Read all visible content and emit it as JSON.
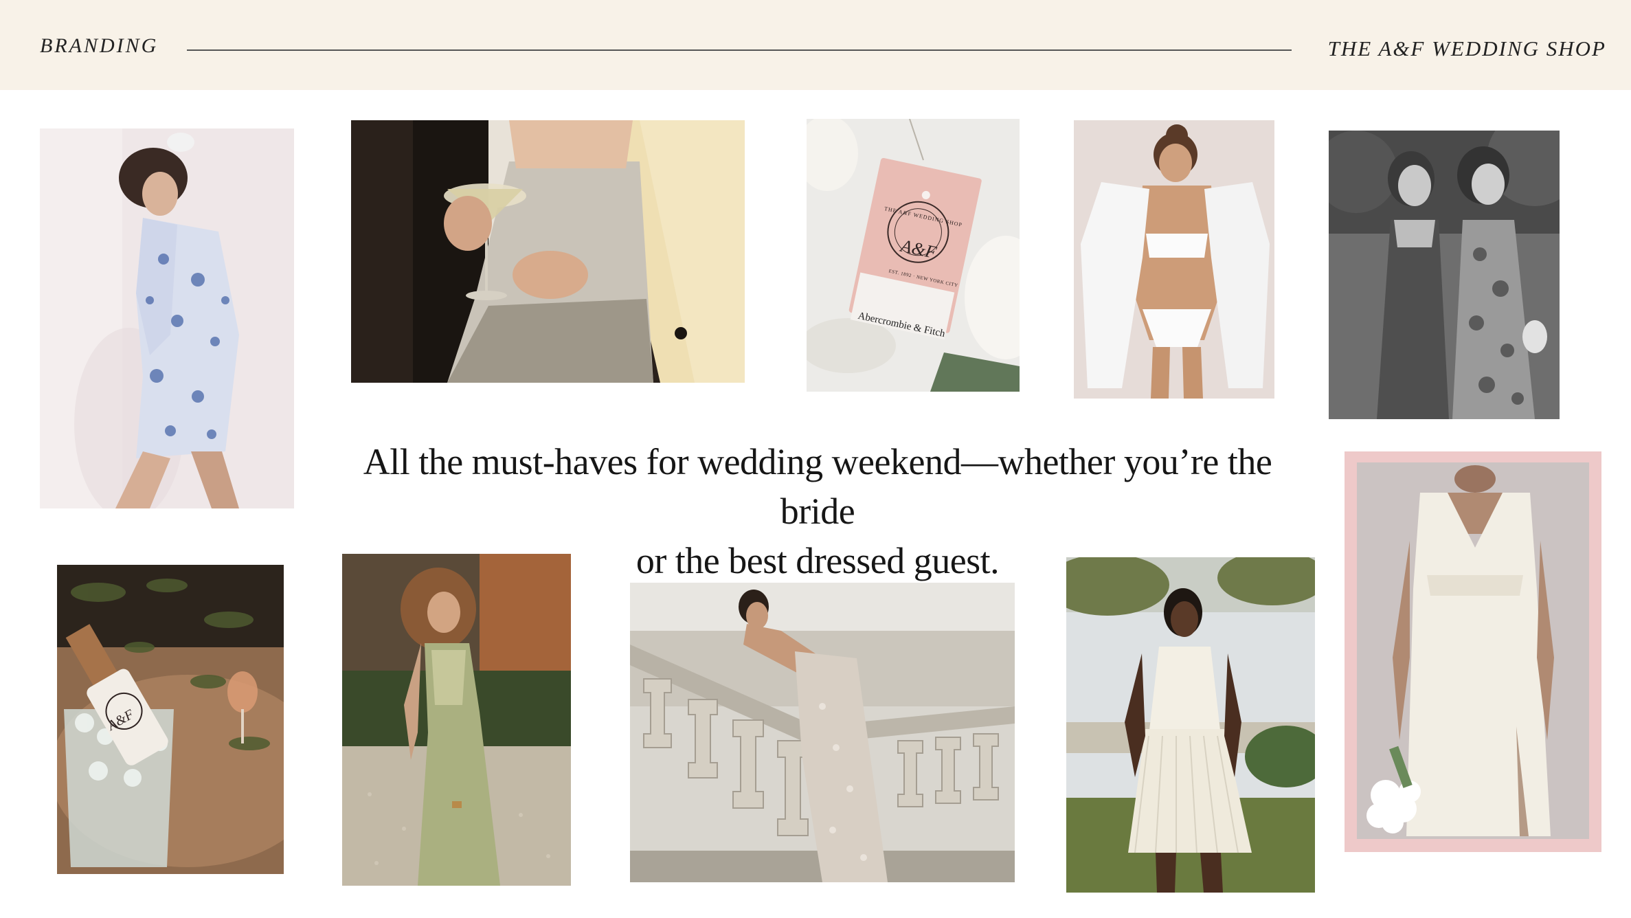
{
  "header": {
    "section_label": "BRANDING",
    "brand_label": "THE A&F WEDDING SHOP"
  },
  "tagline": {
    "line1": "All the must-haves for wedding weekend—whether you’re the bride",
    "line2": "or the best dressed guest."
  },
  "hang_tag": {
    "seal_text": "THE A&F WEDDING SHOP",
    "seal_sub": "EST. 1892 · NEW YORK CITY",
    "monogram": "A&F",
    "label_text": "Abercrombie & Fitch"
  },
  "bottle": {
    "monogram": "A&F"
  },
  "colors": {
    "header_bg": "#f8f2e8",
    "text": "#161616",
    "pink_frame": "#eec9c9",
    "tag_pink": "#e9bcb4"
  }
}
